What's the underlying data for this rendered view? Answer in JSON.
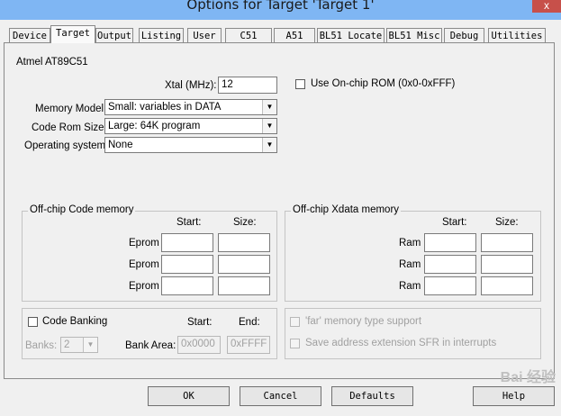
{
  "window": {
    "title": "Options for Target 'Target 1'",
    "close_glyph": "x"
  },
  "tabs": [
    {
      "label": "Device"
    },
    {
      "label": "Target"
    },
    {
      "label": "Output"
    },
    {
      "label": "Listing"
    },
    {
      "label": "User"
    },
    {
      "label": "C51"
    },
    {
      "label": "A51"
    },
    {
      "label": "BL51 Locate"
    },
    {
      "label": "BL51 Misc"
    },
    {
      "label": "Debug"
    },
    {
      "label": "Utilities"
    }
  ],
  "target": {
    "device_name": "Atmel AT89C51",
    "xtal_label": "Xtal (MHz):",
    "xtal_value": "12",
    "onchip_rom_label": "Use On-chip ROM (0x0-0xFFF)",
    "memory_model_label": "Memory Model:",
    "memory_model_value": "Small: variables in DATA",
    "code_rom_label": "Code Rom Size:",
    "code_rom_value": "Large: 64K program",
    "os_label": "Operating system:",
    "os_value": "None"
  },
  "code_memory": {
    "legend": "Off-chip Code memory",
    "start_header": "Start:",
    "size_header": "Size:",
    "rows": [
      {
        "label": "Eprom"
      },
      {
        "label": "Eprom"
      },
      {
        "label": "Eprom"
      }
    ]
  },
  "xdata_memory": {
    "legend": "Off-chip Xdata memory",
    "start_header": "Start:",
    "size_header": "Size:",
    "rows": [
      {
        "label": "Ram"
      },
      {
        "label": "Ram"
      },
      {
        "label": "Ram"
      }
    ]
  },
  "banking": {
    "code_banking_label": "Code Banking",
    "start_header": "Start:",
    "end_header": "End:",
    "banks_label": "Banks:",
    "banks_value": "2",
    "bank_area_label": "Bank Area:",
    "bank_start": "0x0000",
    "bank_end": "0xFFFF"
  },
  "misc": {
    "far_memory_label": "'far' memory type support",
    "save_sfr_label": "Save address extension SFR in interrupts"
  },
  "buttons": {
    "ok": "OK",
    "cancel": "Cancel",
    "defaults": "Defaults",
    "help": "Help"
  },
  "watermark": "Bai 经验"
}
